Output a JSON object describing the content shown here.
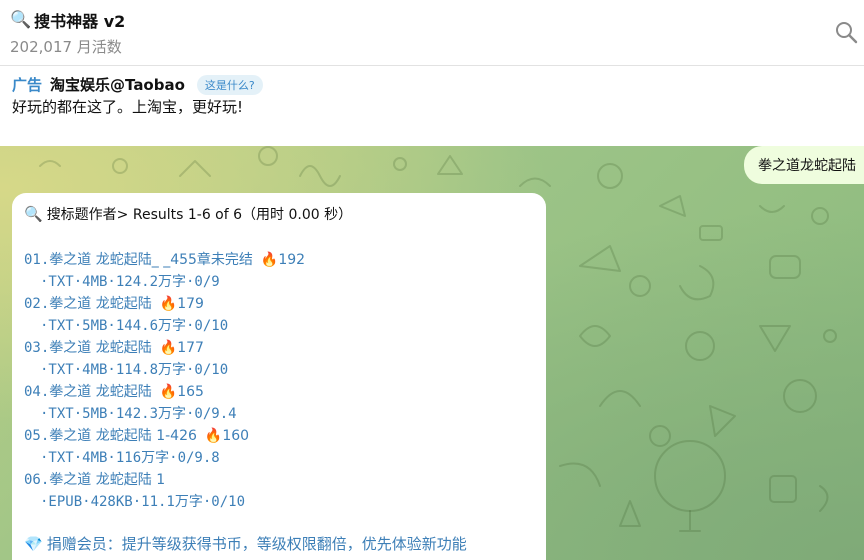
{
  "header": {
    "title_icon": "magnifier-emoji",
    "title": "搜书神器 v2",
    "subtitle": "202,017 月活数",
    "search_icon": "search-icon"
  },
  "ad": {
    "label": "广告",
    "name": "淘宝娱乐@Taobao",
    "what_label": "这是什么?",
    "text": "好玩的都在这了。上淘宝，更好玩!"
  },
  "chat": {
    "outgoing_message": "拳之道龙蛇起陆",
    "result_header": "搜标题作者> Results 1-6 of 6（用时 0.00 秒）",
    "results": [
      {
        "num": "01.",
        "title": "拳之道 龙蛇起陆_ _455章未完结",
        "heat": "192",
        "meta": "·TXT·4MB·124.2万字·0/9"
      },
      {
        "num": "02.",
        "title": "拳之道 龙蛇起陆",
        "heat": "179",
        "meta": "·TXT·5MB·144.6万字·0/10"
      },
      {
        "num": "03.",
        "title": "拳之道 龙蛇起陆",
        "heat": "177",
        "meta": "·TXT·4MB·114.8万字·0/10"
      },
      {
        "num": "04.",
        "title": "拳之道 龙蛇起陆",
        "heat": "165",
        "meta": "·TXT·5MB·142.3万字·0/9.4"
      },
      {
        "num": "05.",
        "title": "拳之道 龙蛇起陆 1-426",
        "heat": "160",
        "meta": "·TXT·4MB·116万字·0/9.8"
      },
      {
        "num": "06.",
        "title": "拳之道 龙蛇起陆 1",
        "heat": "",
        "meta": "·EPUB·428KB·11.1万字·0/10"
      }
    ],
    "donate_text": "捐赠会员：提升等级获得书币，等级权限翻倍，优先体验新功能"
  },
  "colors": {
    "link": "#3d7fb7",
    "ad_label": "#3a89c9",
    "outgoing_bubble": "#effdde"
  }
}
